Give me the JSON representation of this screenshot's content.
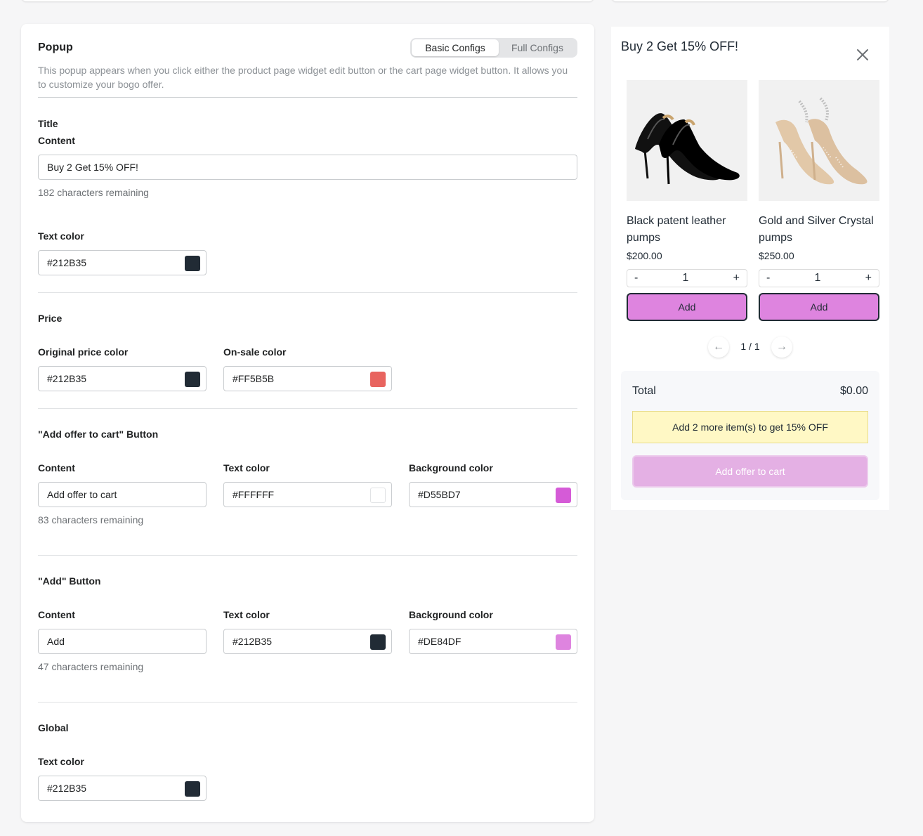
{
  "popup": {
    "title": "Popup",
    "tabs": [
      "Basic Configs",
      "Full Configs"
    ],
    "description": "This popup appears when you click either the product page widget edit button or the cart page widget button. It allows you to customize your bogo offer."
  },
  "title_section": {
    "heading": "Title",
    "content_label": "Content",
    "content_value": "Buy 2 Get 15% OFF!",
    "content_helper": "182 characters remaining",
    "text_color_label": "Text color",
    "text_color_value": "#212B35",
    "text_color_swatch": "#212B35"
  },
  "price_section": {
    "heading": "Price",
    "original_label": "Original price color",
    "original_value": "#212B35",
    "original_swatch": "#212B35",
    "sale_label": "On-sale color",
    "sale_value": "#FF5B5B",
    "sale_swatch": "#E8645F"
  },
  "offer_button_section": {
    "heading": "\"Add offer to cart\" Button",
    "content_label": "Content",
    "content_value": "Add offer to cart",
    "content_helper": "83 characters remaining",
    "text_color_label": "Text color",
    "text_color_value": "#FFFFFF",
    "text_color_swatch": "#FFFFFF",
    "bg_label": "Background color",
    "bg_value": "#D55BD7",
    "bg_swatch": "#D55BD7"
  },
  "add_button_section": {
    "heading": "\"Add\" Button",
    "content_label": "Content",
    "content_value": "Add",
    "content_helper": "47 characters remaining",
    "text_color_label": "Text color",
    "text_color_value": "#212B35",
    "text_color_swatch": "#212B35",
    "bg_label": "Background color",
    "bg_value": "#DE84DF",
    "bg_swatch": "#DE84DF"
  },
  "global_section": {
    "heading": "Global",
    "text_color_label": "Text color",
    "text_color_value": "#212B35",
    "text_color_swatch": "#212B35"
  },
  "preview": {
    "title": "Buy 2 Get 15% OFF!",
    "close_icon": "close-icon",
    "products": [
      {
        "name": "Black patent leather pumps",
        "price": "$200.00",
        "qty": "1",
        "minus": "-",
        "plus": "+",
        "add_label": "Add"
      },
      {
        "name": "Gold and Silver Crystal pumps",
        "price": "$250.00",
        "qty": "1",
        "minus": "-",
        "plus": "+",
        "add_label": "Add"
      }
    ],
    "pager": {
      "text": "1 / 1",
      "prev_icon": "arrow-left-icon",
      "next_icon": "arrow-right-icon",
      "prev_glyph": "←",
      "next_glyph": "→"
    },
    "total_label": "Total",
    "total_value": "$0.00",
    "notice": "Add 2 more item(s) to get 15% OFF",
    "offer_button": "Add offer to cart"
  }
}
